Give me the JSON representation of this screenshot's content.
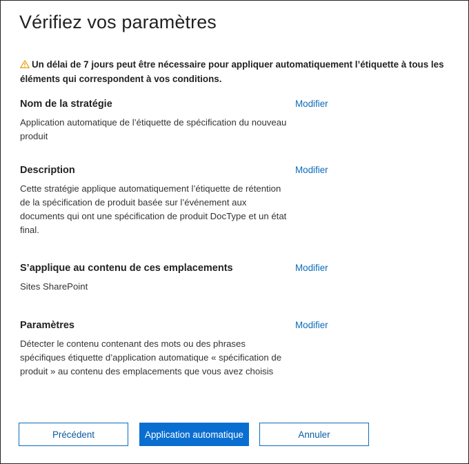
{
  "title": "Vérifiez vos paramètres",
  "warning": {
    "icon": "warning-triangle-icon",
    "text": "Un délai de 7 jours peut être nécessaire pour appliquer automatiquement l’étiquette à tous les éléments qui correspondent à vos conditions."
  },
  "sections": [
    {
      "title": "Nom de la stratégie",
      "body": "Application automatique de l’étiquette de spécification du nouveau produit",
      "action": "Modifier"
    },
    {
      "title": "Description",
      "body": "Cette stratégie applique automatiquement l’étiquette de rétention de la spécification de produit basée sur l’événement aux documents qui ont une spécification de produit DocType et un état final.",
      "action": "Modifier"
    },
    {
      "title": "S’applique au contenu de ces emplacements",
      "body": "Sites SharePoint",
      "action": "Modifier"
    },
    {
      "title": "Paramètres",
      "body": "Détecter le contenu contenant des mots ou des phrases spécifiques étiquette d’application automatique « spécification de produit » au contenu des emplacements que vous avez choisis",
      "action": "Modifier"
    }
  ],
  "buttons": {
    "back": "Précédent",
    "apply": "Application automatique",
    "cancel": "Annuler"
  },
  "colors": {
    "accent": "#0a6ed1",
    "link": "#0a6ab8",
    "warning": "#e8a317"
  }
}
